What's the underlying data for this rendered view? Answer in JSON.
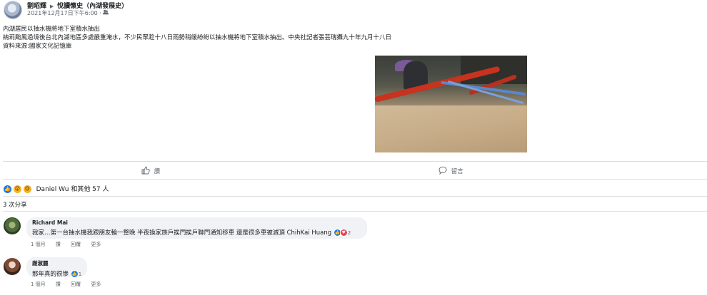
{
  "post": {
    "author": "劉昭輝",
    "group": "悅讀懷史（內湖發展史）",
    "timestamp": "2021年12月17日下午6:00",
    "privacy_symbol": "·",
    "privacy_icon": "group-icon",
    "text_lines": [
      "內湖居民以抽水機將地下室積水抽出",
      "納莉颱風過境後台北內湖地區多處嚴重淹水，不少民眾趁十八日雨勢稍緩紛紛以抽水機將地下室積水抽出。中央社記者張芸瑞攝九十年九月十八日",
      "資料來源:國家文化記憶庫"
    ]
  },
  "actions": {
    "like_label": "讚",
    "comment_label": "留言"
  },
  "reactions": {
    "summary": "Daniel Wu 和其他 57 人",
    "icons": [
      "like",
      "wow",
      "sad"
    ],
    "colors": {
      "like": "#1877f2",
      "wow": "#f7b125",
      "love": "#e4405f"
    }
  },
  "shares": "3 次分享",
  "comments": [
    {
      "name": "Richard Mai",
      "text": "我家…第一台抽水機我跟朋友輪一整晚 半夜換家族戶挨門挨戶聯門通知移車 還是很多車被滅頂 ChihKai Huang",
      "reaction_count": "2",
      "footer": {
        "time": "1 個月",
        "like": "讚",
        "reply": "回覆",
        "more": "更多"
      }
    },
    {
      "name": "謝淑麗",
      "text": "那年真的很慘",
      "reaction_count": "1",
      "footer": {
        "time": "1 個月",
        "like": "讚",
        "reply": "回覆",
        "more": "更多"
      }
    }
  ]
}
